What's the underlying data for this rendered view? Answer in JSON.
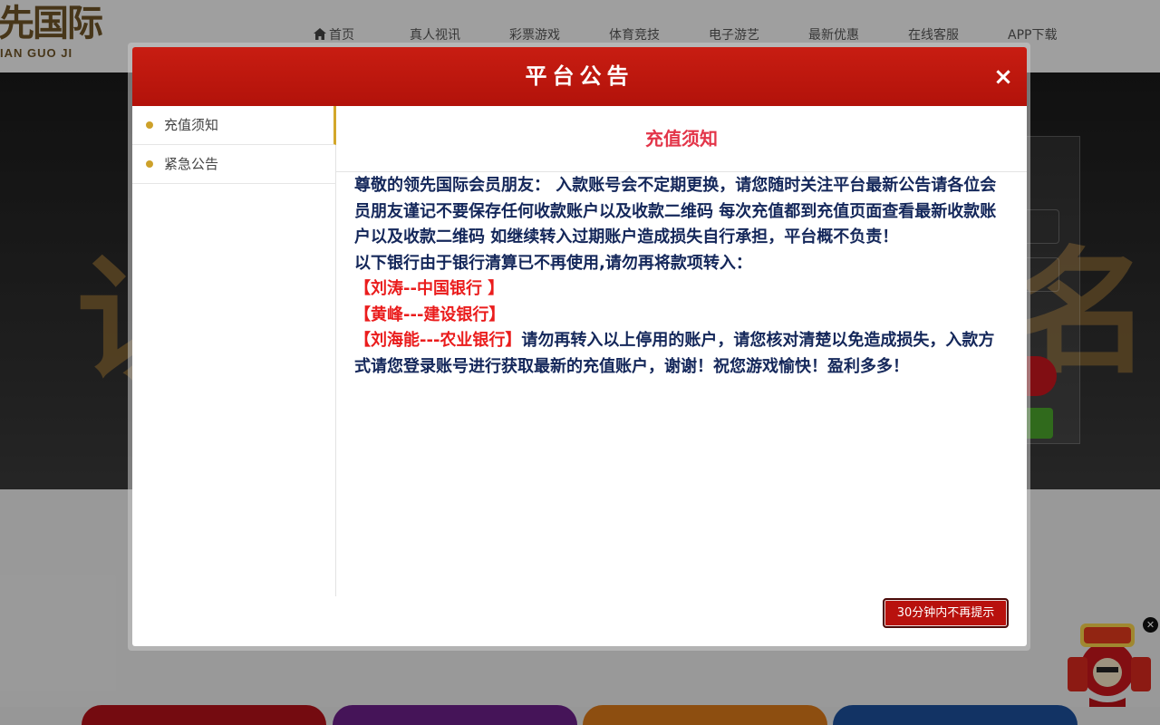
{
  "site": {
    "logo_text": "先国际",
    "logo_subtext": "IAN GUO JI",
    "nav": {
      "home": "首页",
      "live": "真人视讯",
      "lottery": "彩票游戏",
      "sports": "体育竞技",
      "egames": "电子游艺",
      "promo": "最新优惠",
      "service": "在线客服",
      "app": "APP下载"
    }
  },
  "modal": {
    "title": "平台公告",
    "close_symbol": "×",
    "tabs": [
      {
        "label": "充值须知",
        "active": true
      },
      {
        "label": "紧急公告",
        "active": false
      }
    ],
    "content_title": "充值须知",
    "body": {
      "p1": "尊敬的领先国际会员朋友： 入款账号会不定期更换，请您随时关注平台最新公告请各位会员朋友谨记不要保存任何收款账户以及收款二维码 每次充值都到充值页面查看最新收款账户以及收款二维码 如继续转入过期账户造成损失自行承担，平台概不负责！",
      "p2": "以下银行由于银行清算已不再使用,请勿再将款项转入：",
      "bank1": "【刘涛--中国银行 】",
      "bank2": "【黄峰---建设银行】",
      "bank3": "【刘海能---农业银行】",
      "p3": "请勿再转入以上停用的账户，请您核对清楚以免造成损失，入款方式请您登录账号进行获取最新的充值账户，谢谢！祝您游戏愉快！盈利多多！"
    },
    "dismiss_button": "30分钟内不再提示"
  },
  "colors": {
    "header_red": "#c81d12",
    "accent_gold": "#cda12a",
    "title_pink": "#e33549",
    "body_navy": "#14275a",
    "bank_red": "#ea1c1c"
  }
}
